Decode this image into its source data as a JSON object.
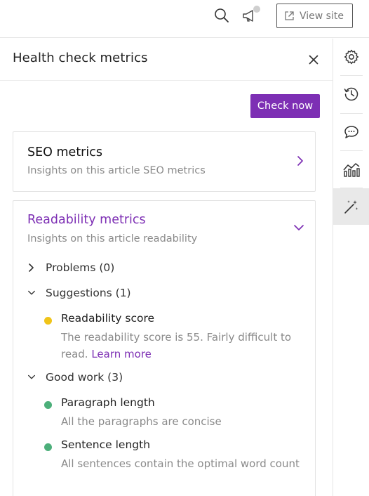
{
  "topbar": {
    "search_icon": "search-icon",
    "announce_icon": "megaphone-icon",
    "view_site_label": "View site",
    "view_site_icon": "external-link-icon"
  },
  "panel": {
    "title": "Health check metrics",
    "close_icon": "close-icon",
    "check_button_label": "Check now",
    "accent_color": "#7d2fb4"
  },
  "seo": {
    "title": "SEO metrics",
    "subtitle": "Insights on this article SEO metrics",
    "expanded": false
  },
  "readability": {
    "title": "Readability metrics",
    "subtitle": "Insights on this article readability",
    "expanded": true,
    "problems": {
      "label": "Problems (0)",
      "expanded": false
    },
    "suggestions": {
      "label": "Suggestions (1)",
      "expanded": true,
      "items": [
        {
          "title": "Readability score",
          "description": "The readability score is 55. Fairly difficult to read.",
          "link": "Learn more",
          "status_color": "#f0c419"
        }
      ]
    },
    "good_work": {
      "label": "Good work (3)",
      "expanded": true,
      "items": [
        {
          "title": "Paragraph length",
          "description": "All the paragraphs are concise",
          "status_color": "#4caf7a"
        },
        {
          "title": "Sentence length",
          "description": "All sentences contain the optimal word count",
          "status_color": "#4caf7a"
        }
      ]
    }
  },
  "rail": {
    "items": [
      {
        "icon": "gear-icon",
        "active": false
      },
      {
        "icon": "history-icon",
        "active": false
      },
      {
        "icon": "comment-icon",
        "active": false
      },
      {
        "icon": "analytics-icon",
        "active": false
      },
      {
        "icon": "magic-wand-icon",
        "active": true
      }
    ]
  }
}
